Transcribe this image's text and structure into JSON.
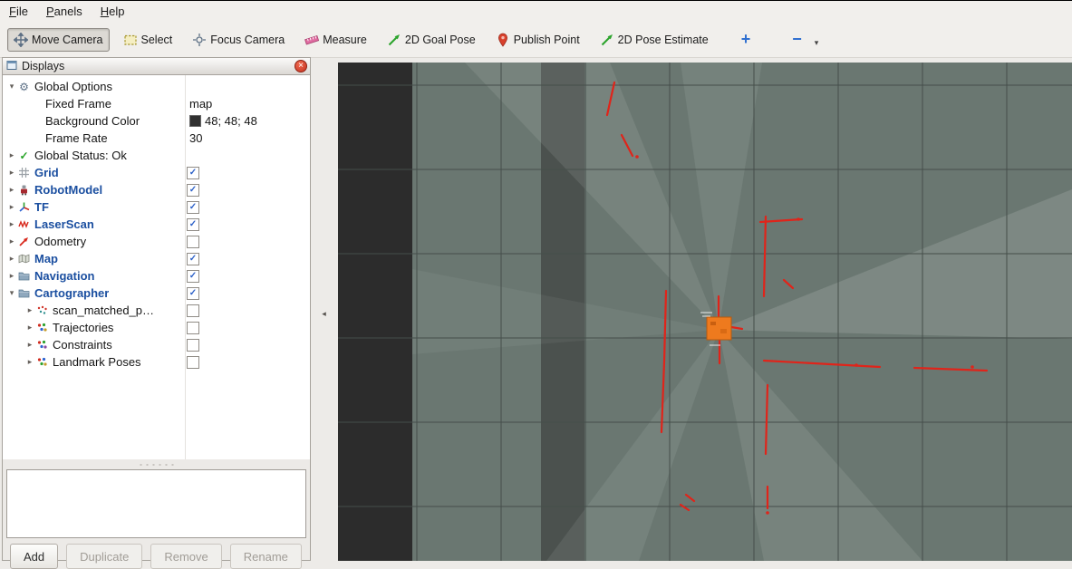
{
  "window": {
    "menu": [
      "File",
      "Panels",
      "Help"
    ]
  },
  "toolbar": {
    "tools": [
      {
        "label": "Move Camera",
        "icon": "move-camera-icon",
        "active": true
      },
      {
        "label": "Select",
        "icon": "select-icon",
        "active": false
      },
      {
        "label": "Focus Camera",
        "icon": "focus-camera-icon",
        "active": false
      },
      {
        "label": "Measure",
        "icon": "measure-icon",
        "active": false
      },
      {
        "label": "2D Goal Pose",
        "icon": "goal-pose-icon",
        "active": false
      },
      {
        "label": "Publish Point",
        "icon": "publish-point-icon",
        "active": false
      },
      {
        "label": "2D Pose Estimate",
        "icon": "pose-estimate-icon",
        "active": false
      }
    ],
    "add_tool": "+",
    "remove_tool": "−",
    "remove_caret": "▾"
  },
  "displays": {
    "title": "Displays",
    "close": "×",
    "rows": [
      {
        "arrow": "▾",
        "gear": "⚙",
        "label": "Global Options"
      },
      {
        "label": "Fixed Frame",
        "value": "map"
      },
      {
        "label": "Background Color",
        "value": "48; 48; 48",
        "swatch": "#303030"
      },
      {
        "label": "Frame Rate",
        "value": "30"
      },
      {
        "arrow": "▸",
        "check_glyph": "✓",
        "label": "Global Status: Ok"
      },
      {
        "arrow": "▸",
        "label": "Grid",
        "check": "✓",
        "enabled": true
      },
      {
        "arrow": "▸",
        "label": "RobotModel",
        "check": "✓",
        "enabled": true
      },
      {
        "arrow": "▸",
        "label": "TF",
        "check": "✓",
        "enabled": true
      },
      {
        "arrow": "▸",
        "label": "LaserScan",
        "check": "✓",
        "enabled": true
      },
      {
        "arrow": "▸",
        "label": "Odometry",
        "check": "",
        "enabled": false
      },
      {
        "arrow": "▸",
        "label": "Map",
        "check": "✓",
        "enabled": true
      },
      {
        "arrow": "▸",
        "label": "Navigation",
        "check": "✓",
        "enabled": true
      },
      {
        "arrow": "▾",
        "label": "Cartographer",
        "check": "✓",
        "enabled": true
      },
      {
        "arrow": "▸",
        "label": "scan_matched_p…",
        "check": "",
        "enabled": false
      },
      {
        "arrow": "▸",
        "label": "Trajectories",
        "check": "",
        "enabled": false
      },
      {
        "arrow": "▸",
        "label": "Constraints",
        "check": "",
        "enabled": false
      },
      {
        "arrow": "▸",
        "label": "Landmark Poses",
        "check": "",
        "enabled": false
      }
    ],
    "buttons": [
      {
        "label": "Add",
        "enabled": true
      },
      {
        "label": "Duplicate",
        "enabled": false
      },
      {
        "label": "Remove",
        "enabled": false
      },
      {
        "label": "Rename",
        "enabled": false
      }
    ]
  },
  "splitter": {
    "collapse": "◂"
  },
  "viewport": {
    "background_color": "#2e2e2e",
    "map_color": "#73827b",
    "scan_color": "#e0241a",
    "robot_color": "#ee7a1e",
    "grid_color": "#454e4a"
  }
}
